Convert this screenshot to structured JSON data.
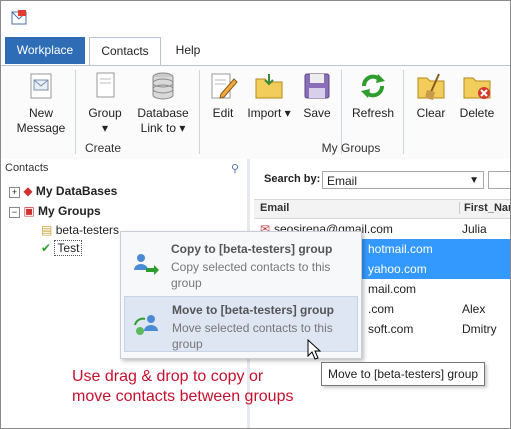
{
  "tabs": {
    "workplace": "Workplace",
    "contacts": "Contacts",
    "help": "Help"
  },
  "ribbon": {
    "new_message": {
      "line1": "New",
      "line2": "Message"
    },
    "group": {
      "label": "Group"
    },
    "database_link": {
      "line1": "Database",
      "line2": "Link to"
    },
    "edit": "Edit",
    "import": "Import",
    "save": "Save",
    "refresh": "Refresh",
    "clear": "Clear",
    "delete": "Delete",
    "group_create": "Create",
    "group_my_groups": "My Groups"
  },
  "left_pane": {
    "title": "Contacts",
    "tree": {
      "my_databases": "My DataBases",
      "my_groups": "My Groups",
      "beta_testers": "beta-testers",
      "test": "Test"
    }
  },
  "right_pane": {
    "search_by_label": "Search by:",
    "search_by_value": "Email",
    "columns": {
      "email": "Email",
      "first_name": "First_Nar"
    },
    "rows": [
      {
        "email": "seosirena@gmail.com",
        "first_name": "Julia",
        "selected": false
      },
      {
        "email": "hotmail.com",
        "first_name": "",
        "selected": true
      },
      {
        "email": "yahoo.com",
        "first_name": "",
        "selected": true
      },
      {
        "email": "mail.com",
        "first_name": "",
        "selected": false
      },
      {
        "email": ".com",
        "first_name": "Alex",
        "selected": false
      },
      {
        "email": "soft.com",
        "first_name": "Dmitry",
        "selected": false
      }
    ]
  },
  "popup": {
    "copy": {
      "title": "Copy to [beta-testers] group",
      "desc": "Copy selected contacts to this group"
    },
    "move": {
      "title": "Move to [beta-testers] group",
      "desc": "Move selected contacts to this group"
    }
  },
  "tooltip": "Move to [beta-testers] group",
  "note": {
    "line1": "Use drag & drop to copy or",
    "line2": "move contacts between groups"
  },
  "colors": {
    "accent": "#2e6db6",
    "selection": "#3399ff",
    "note": "#c8102e"
  }
}
